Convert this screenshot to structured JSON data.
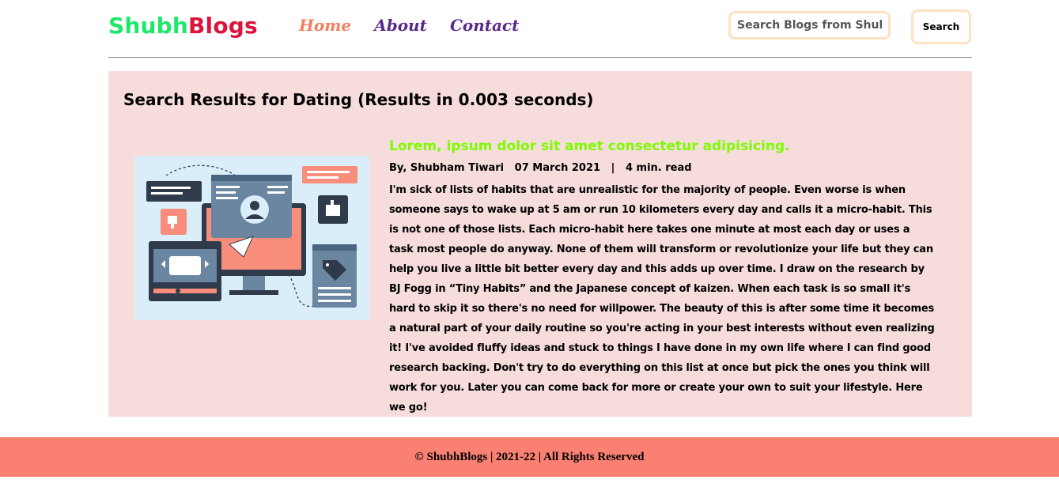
{
  "header": {
    "logo_part1": "Shubh",
    "logo_part2": "Blogs",
    "nav": [
      {
        "label": "Home"
      },
      {
        "label": "About"
      },
      {
        "label": "Contact"
      }
    ],
    "search_placeholder": "Search Blogs from Shubh",
    "search_button": "Search"
  },
  "results": {
    "heading": "Search Results for Dating (Results in 0.003 seconds)",
    "post": {
      "title": "Lorem, ipsum dolor sit amet consectetur adipisicing.",
      "meta": "By, Shubham Tiwari   07 March 2021   |   4 min. read",
      "excerpt": "I'm sick of lists of habits that are unrealistic for the majority of people. Even worse is when someone says to wake up at 5 am or run 10 kilometers every day and calls it a micro-habit. This is not one of those lists. Each micro-habit here takes one minute at most each day or uses a task most people do anyway. None of them will transform or revolutionize your life but they can help you live a little bit better every day and this adds up over time. I draw on the research by BJ Fogg in “Tiny Habits” and the Japanese concept of kaizen. When each task is so small it's hard to skip it so there's no need for willpower. The beauty of this is after some time it becomes a natural part of your daily routine so you're acting in your best interests without even realizing it! I've avoided fluffy ideas and stuck to things I have done in my own life where I can find good research backing. Don't try to do everything on this list at once but pick the ones you think will work for you. Later you can come back for more or create your own to suit your lifestyle. Here we go!"
    }
  },
  "footer": {
    "text": "© ShubhBlogs | 2021-22 | All Rights Reserved"
  }
}
